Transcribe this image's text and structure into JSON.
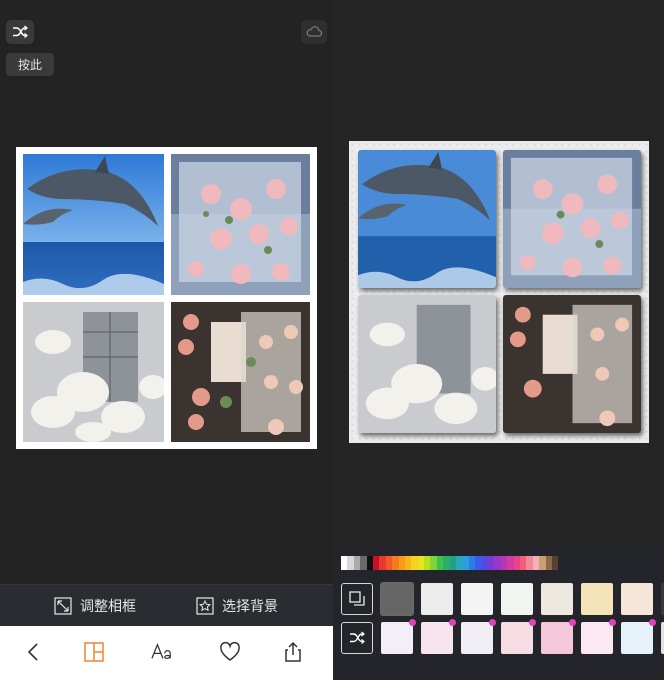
{
  "left": {
    "tooltip": "按此",
    "shuffle_icon": "shuffle-icon",
    "cloud_icon": "cloud-icon",
    "photos": [
      {
        "name": "dolphins",
        "icon": "photo-dolphins"
      },
      {
        "name": "ice-roses",
        "icon": "photo-ice-roses"
      },
      {
        "name": "white-magnolia",
        "icon": "photo-white-magnolia"
      },
      {
        "name": "shop-flowers",
        "icon": "photo-shop-flowers"
      }
    ],
    "sub_toolbar": {
      "adjust_frame": "调整相框",
      "choose_background": "选择背景"
    },
    "tabs": [
      "back-icon",
      "layout-icon",
      "text-icon",
      "heart-icon",
      "share-icon"
    ],
    "colors": {
      "accent": "#f08a3c"
    }
  },
  "right": {
    "palette": [
      "#ffffff",
      "#d8d8d8",
      "#aaaaaa",
      "#6a6a6a",
      "#111111",
      "#c8102e",
      "#e83a2a",
      "#f05a28",
      "#f47c20",
      "#f79a1e",
      "#f9b61c",
      "#f7d21e",
      "#e6e61e",
      "#b8e01e",
      "#7fd43a",
      "#3fc24a",
      "#2aae6a",
      "#22a08c",
      "#2aa8b8",
      "#28a0e0",
      "#2a7ee8",
      "#3a5ce8",
      "#5a46e0",
      "#7a3ad8",
      "#9a36c8",
      "#b438b4",
      "#d43aa0",
      "#e8448a",
      "#f0607a",
      "#f28a9a",
      "#f4b0b8",
      "#c8a070",
      "#8a6a48",
      "#5a4030"
    ],
    "bg_row1": [
      {
        "name": "solid-gray",
        "color": "#666666"
      },
      {
        "name": "paper-white",
        "color": "#ececec"
      },
      {
        "name": "paper-plain",
        "color": "#f4f4f4"
      },
      {
        "name": "grid-light",
        "color": "#f2f4f2"
      },
      {
        "name": "grid-beige",
        "color": "#ece8e0"
      },
      {
        "name": "parchment",
        "color": "#f4e2b8"
      },
      {
        "name": "stripe-peach",
        "color": "#f6e6d8"
      },
      {
        "name": "dark-edge",
        "color": "#3a3a3a"
      }
    ],
    "bg_row2": [
      {
        "name": "pattern-rainbow",
        "color": "#f4eef8"
      },
      {
        "name": "pattern-pink-cute",
        "color": "#f8e4ec"
      },
      {
        "name": "pattern-letters",
        "color": "#f2eef6"
      },
      {
        "name": "pattern-pink-dots",
        "color": "#f8dce4"
      },
      {
        "name": "pattern-hot-pink",
        "color": "#f4c8d8"
      },
      {
        "name": "pattern-hearts",
        "color": "#fbe8f0"
      },
      {
        "name": "pattern-blue-hearts",
        "color": "#e6f2fa"
      },
      {
        "name": "pattern-edge",
        "color": "#e8e0e0"
      }
    ],
    "tool_icons": [
      "frame-layers-icon",
      "shuffle-icon"
    ]
  }
}
